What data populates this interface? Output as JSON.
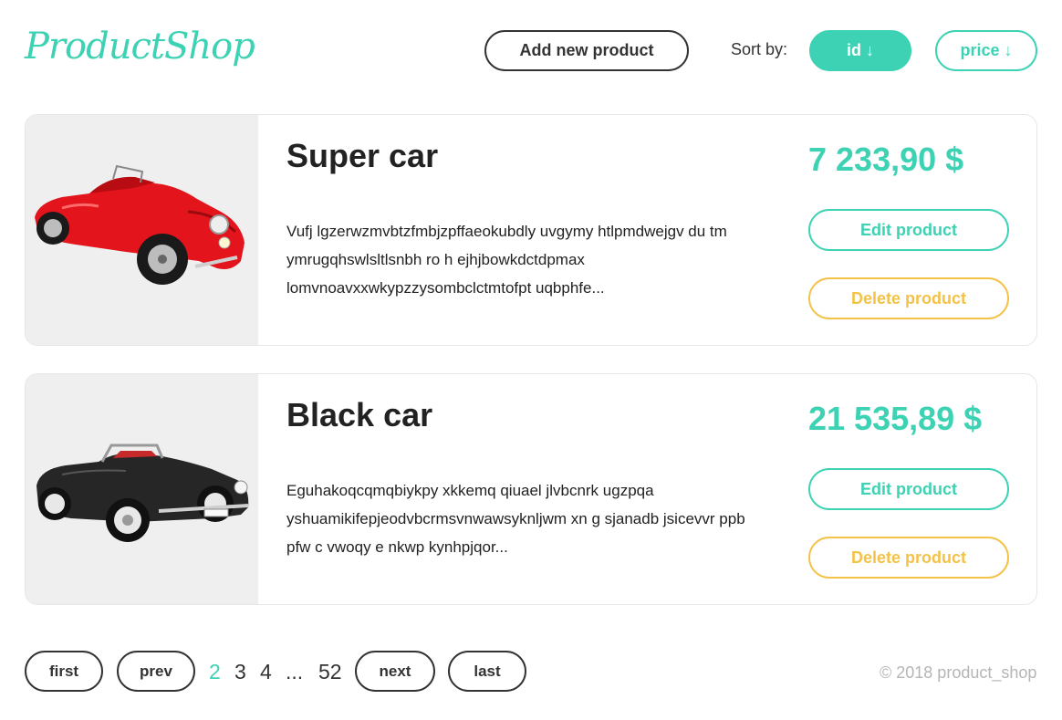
{
  "header": {
    "logo": "ProductShop",
    "add_button": "Add new product",
    "sort_label": "Sort by:",
    "sort_id": "id ↓",
    "sort_price": "price ↓"
  },
  "products": [
    {
      "title": "Super car",
      "description": "Vufj lgzerwzmvbtzfmbjzpffaeokubdly uvgymy htlpmdwejgv du tm ymrugqhswlsltlsnbh ro h ejhjbowkdctdpmax lomvnoavxxwkypzzysombclctmtofpt uqbphfe...",
      "price": "7 233,90 $",
      "edit_label": "Edit product",
      "delete_label": "Delete product",
      "image_icon": "red-convertible-car-image"
    },
    {
      "title": "Black car",
      "description": "Eguhakoqcqmqbiykpy xkkemq qiuael jlvbcnrk ugzpqa yshuamikifepjeodvbcrmsvnwawsyknljwm xn g sjanadb jsicevvr ppb pfw c vwoqy e nkwp kynhpjqor...",
      "price": "21 535,89 $",
      "edit_label": "Edit product",
      "delete_label": "Delete product",
      "image_icon": "black-convertible-car-image"
    }
  ],
  "pagination": {
    "first": "first",
    "prev": "prev",
    "pages": [
      "2",
      "3",
      "4",
      "...",
      "52"
    ],
    "active_page": "2",
    "next": "next",
    "last": "last"
  },
  "footer": "© 2018 product_shop",
  "colors": {
    "accent": "#3dd2b3",
    "warning": "#f3c247",
    "dark": "#333333"
  }
}
